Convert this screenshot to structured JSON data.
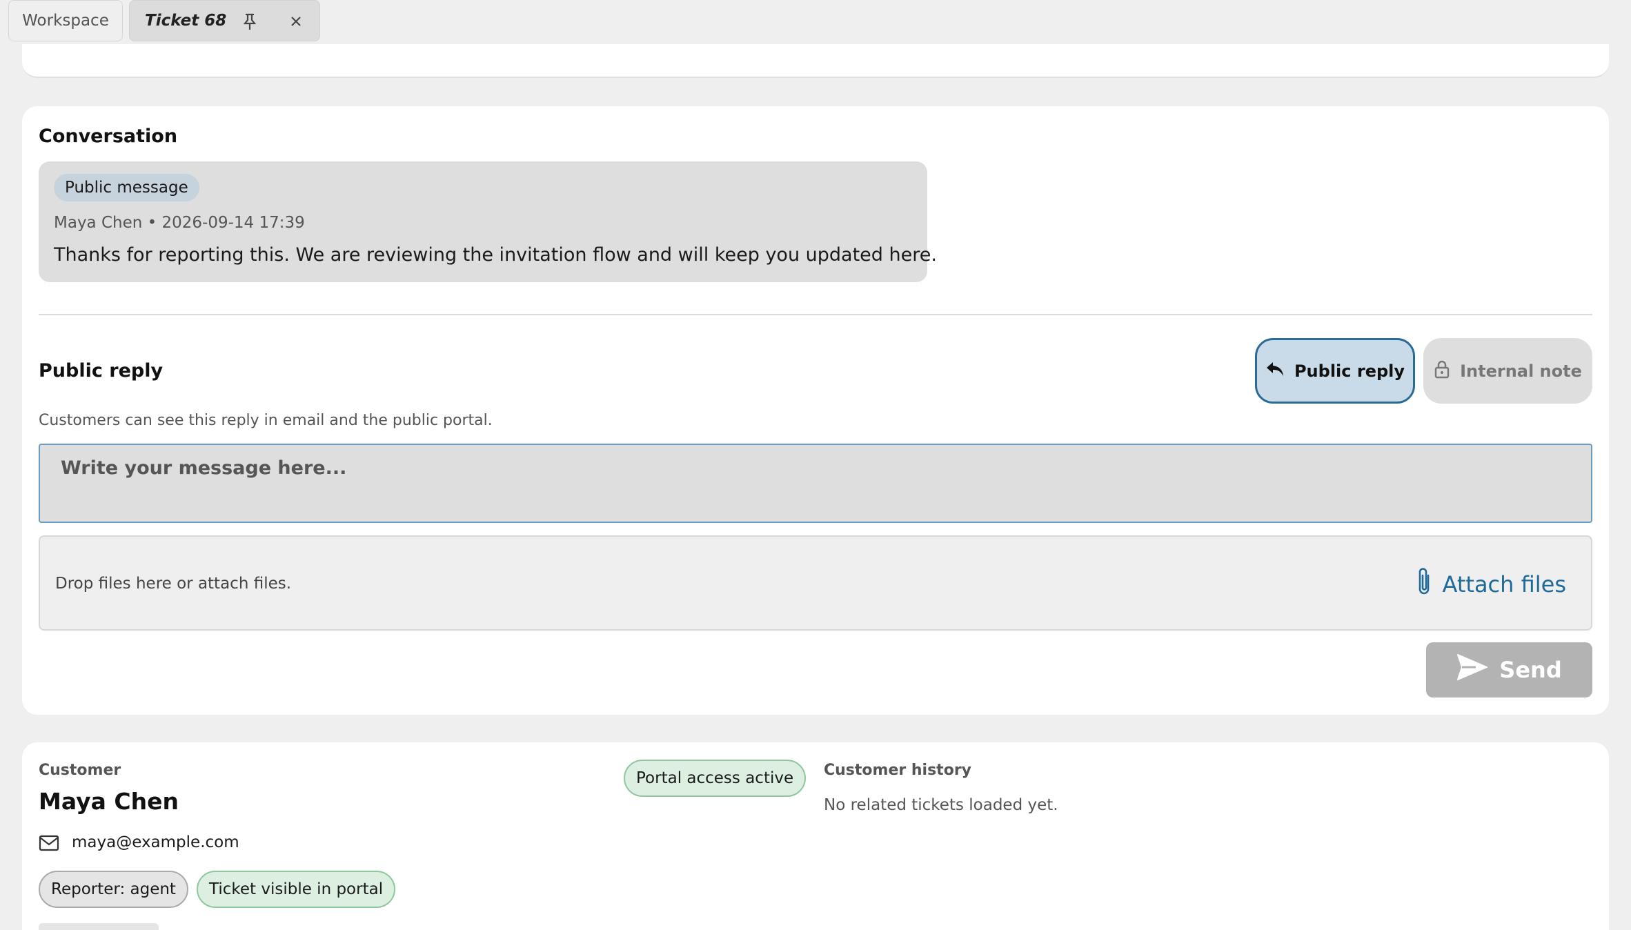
{
  "tabs": {
    "workspace_label": "Workspace",
    "ticket_label": "Ticket 68",
    "pin_icon": "pin-icon",
    "close_icon": "close-icon"
  },
  "conversation": {
    "title": "Conversation",
    "messages": [
      {
        "badge": "Public message",
        "meta": "Maya Chen • 2026-09-14 17:39",
        "body": "Thanks for reporting this. We are reviewing the invitation flow and will keep you updated here."
      }
    ]
  },
  "reply": {
    "title": "Public reply",
    "modes": {
      "public_label": "Public reply",
      "public_icon": "reply-arrow-icon",
      "internal_label": "Internal note",
      "internal_icon": "lock-icon",
      "selected": "Public reply"
    },
    "helper": "Customers can see this reply in email and the public portal.",
    "message_placeholder": "Write your message here...",
    "message_value": "",
    "dropzone_text": "Drop files here or attach files.",
    "attach_label": "Attach files",
    "attach_icon": "paperclip-icon",
    "send_label": "Send",
    "send_icon": "send-icon"
  },
  "customer": {
    "section_label": "Customer",
    "name": "Maya Chen",
    "email": "maya@example.com",
    "email_icon": "mail-icon",
    "portal_badge": "Portal access active",
    "chips": [
      "Reporter: agent",
      "Ticket visible in portal"
    ],
    "history_label": "Customer history",
    "history_text": "No related tickets loaded yet."
  },
  "colors": {
    "accent": "#1e6a99",
    "selected_mode_bg": "#c9dbe8",
    "selected_mode_border": "#2a6b96",
    "success_bg": "#dcefe1",
    "success_border": "#8fc79f",
    "send_disabled": "#b3b3b3"
  }
}
